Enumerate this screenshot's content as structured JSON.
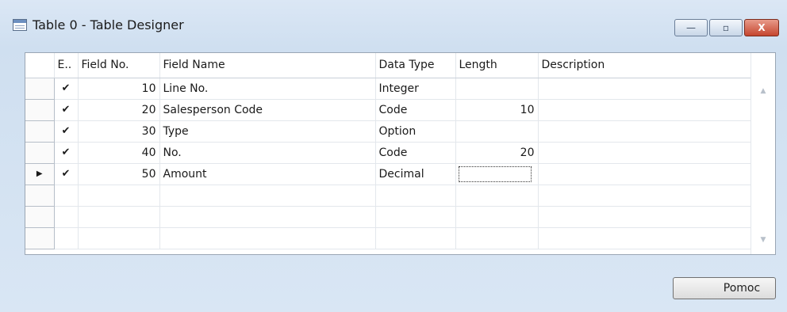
{
  "window": {
    "title": "Table 0 - Table Designer",
    "controls": {
      "minimize": "—",
      "maximize": "▫",
      "close": "X"
    }
  },
  "grid": {
    "columns": [
      "",
      "E..",
      "Field No.",
      "Field Name",
      "Data Type",
      "Length",
      "Description"
    ],
    "rows": [
      {
        "selector": "",
        "enabled": "✔",
        "field_no": "10",
        "field_name": "Line No.",
        "data_type": "Integer",
        "length": "",
        "description": ""
      },
      {
        "selector": "",
        "enabled": "✔",
        "field_no": "20",
        "field_name": "Salesperson Code",
        "data_type": "Code",
        "length": "10",
        "description": ""
      },
      {
        "selector": "",
        "enabled": "✔",
        "field_no": "30",
        "field_name": "Type",
        "data_type": "Option",
        "length": "",
        "description": ""
      },
      {
        "selector": "",
        "enabled": "✔",
        "field_no": "40",
        "field_name": "No.",
        "data_type": "Code",
        "length": "20",
        "description": ""
      },
      {
        "selector": "▶",
        "enabled": "✔",
        "field_no": "50",
        "field_name": "Amount",
        "data_type": "Decimal",
        "length": "",
        "description": ""
      }
    ],
    "empty_rows": 3,
    "scroll": {
      "up": "▲",
      "down": "▼"
    }
  },
  "footer": {
    "help_label": "Pomoc"
  },
  "icons": {
    "title_icon": "table-icon",
    "current_row_marker": "current-row-arrow-icon",
    "check": "check-icon"
  }
}
